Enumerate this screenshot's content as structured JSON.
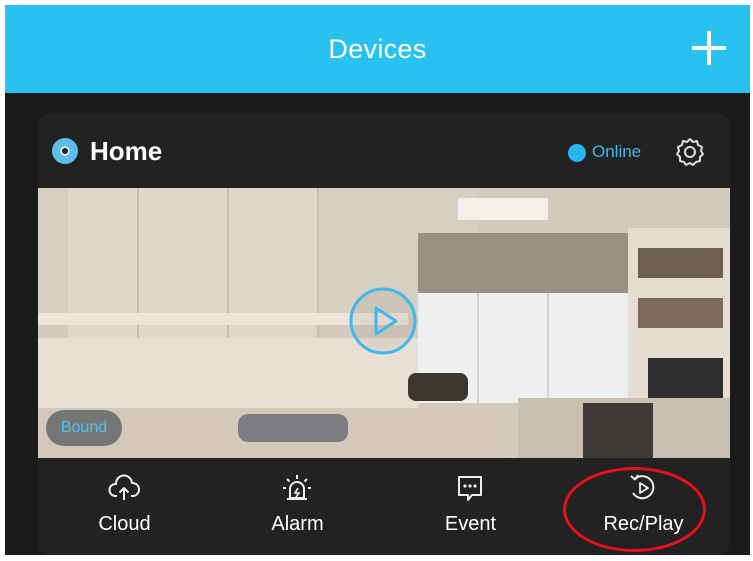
{
  "header": {
    "title": "Devices",
    "add_icon": "plus-icon"
  },
  "device": {
    "name": "Home",
    "icon": "camera-icon",
    "status": "Online",
    "status_color": "#29b3ef",
    "settings_icon": "gear-icon",
    "preview": {
      "play_icon": "play-icon",
      "badge": "Bound"
    }
  },
  "toolbar": {
    "items": [
      {
        "label": "Cloud",
        "icon": "cloud-upload-icon"
      },
      {
        "label": "Alarm",
        "icon": "alarm-light-icon"
      },
      {
        "label": "Event",
        "icon": "message-icon"
      },
      {
        "label": "Rec/Play",
        "icon": "replay-icon"
      }
    ]
  },
  "colors": {
    "accent": "#29c2f0",
    "highlight": "#e8101a"
  }
}
